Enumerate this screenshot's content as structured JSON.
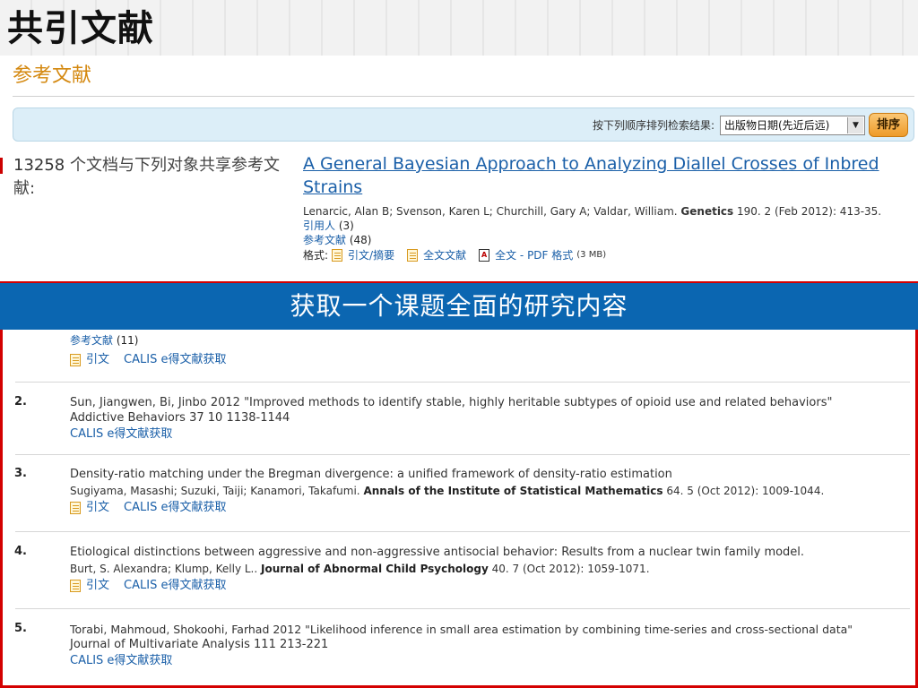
{
  "slide": {
    "title": "共引文献",
    "banner": "获取一个课题全面的研究内容"
  },
  "colors": {
    "section_title": "#d4880f",
    "link": "#1a5fa8",
    "banner_bg": "#0b66b1",
    "frame_red": "#d40000"
  },
  "page": {
    "section_title": "参考文献",
    "sort": {
      "label": "按下列顺序排列检索结果:",
      "selected": "出版物日期(先近后远)",
      "button": "排序"
    },
    "cocite": {
      "count": "13258",
      "text": " 个文档与下列对象共享参考文献:"
    },
    "main_article": {
      "title": "A General Bayesian Approach to Analyzing Diallel Crosses of Inbred Strains",
      "authors": "Lenarcic, Alan B; Svenson, Karen L; Churchill, Gary A; Valdar, William.",
      "journal": "Genetics",
      "details": " 190. 2  (Feb 2012): 413-35.",
      "cited_by_label": "引用人",
      "cited_by_count": " (3)",
      "refs_label": "参考文献",
      "refs_count": " (48)",
      "format_label": "格式:",
      "format_abstract": "引文/摘要",
      "format_fulltext": "全文文献",
      "format_pdf": "全文 - PDF 格式",
      "pdf_size": "(3 MB)"
    }
  },
  "list": {
    "partial": {
      "refs_label": "参考文献",
      "refs_count": " (11)",
      "cite_label": "引文",
      "calis_label": "CALIS e得文献获取"
    },
    "entries": [
      {
        "index": "2.",
        "line1": "Sun, Jiangwen, Bi, Jinbo 2012 \"Improved methods to identify stable, highly heritable subtypes of opioid use and related behaviors\"",
        "line2": "Addictive Behaviors 37 10 1138-1144",
        "calis_label": "CALIS e得文献获取"
      },
      {
        "index": "3.",
        "title": "Density-ratio matching under the Bregman divergence: a unified framework of density-ratio estimation",
        "authors": "Sugiyama, Masashi; Suzuki, Taiji; Kanamori, Takafumi.",
        "journal": "Annals of the Institute of Statistical Mathematics",
        "details": " 64. 5  (Oct 2012): 1009-1044.",
        "cite_label": "引文",
        "calis_label": "CALIS e得文献获取"
      },
      {
        "index": "4.",
        "title": "Etiological distinctions between aggressive and non-aggressive antisocial behavior: Results from a nuclear twin family model.",
        "authors": "Burt, S. Alexandra; Klump, Kelly L..",
        "journal": "Journal of Abnormal Child Psychology",
        "details": " 40. 7  (Oct 2012): 1059-1071.",
        "cite_label": "引文",
        "calis_label": "CALIS e得文献获取"
      },
      {
        "index": "5.",
        "line1": "Torabi, Mahmoud, Shokoohi, Farhad 2012 \"Likelihood inference in small area estimation by combining time-series and cross-sectional data\"",
        "line2": "Journal of Multivariate Analysis 111 213-221",
        "calis_label": "CALIS e得文献获取"
      }
    ]
  }
}
